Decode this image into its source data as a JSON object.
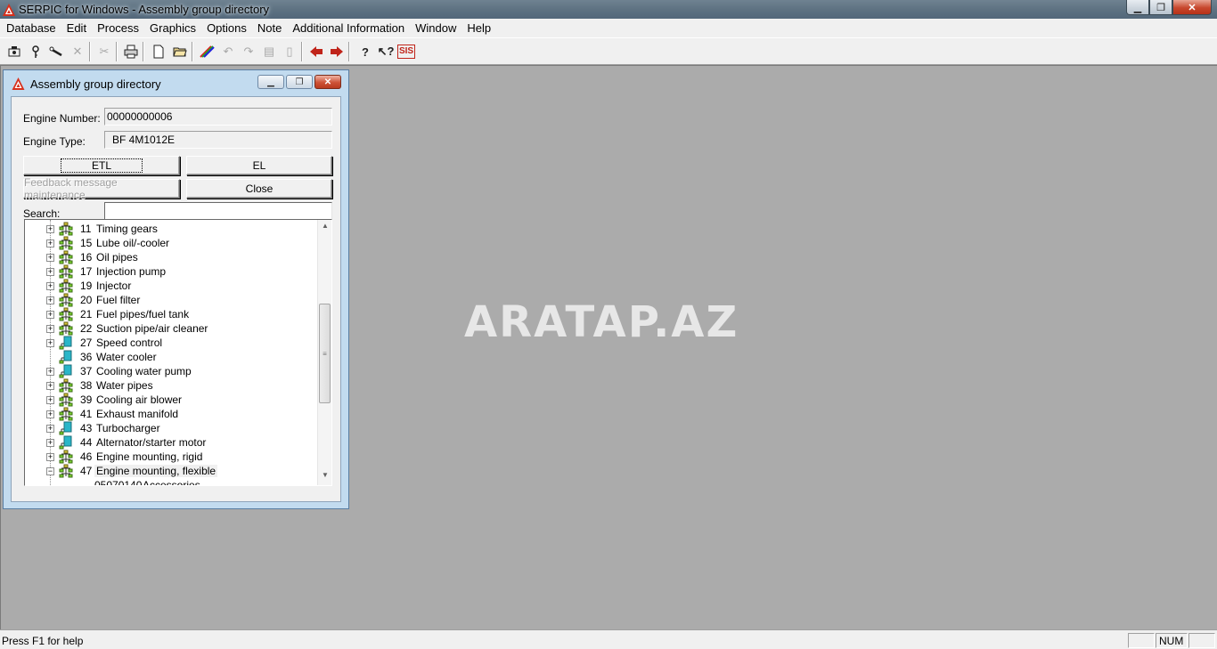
{
  "app": {
    "title": "SERPIC for Windows - Assembly group directory"
  },
  "menu": [
    "Database",
    "Edit",
    "Process",
    "Graphics",
    "Options",
    "Note",
    "Additional Information",
    "Window",
    "Help"
  ],
  "toolbar": {
    "icons": [
      "motor-icon",
      "key-icon",
      "wrench-icon",
      "delete-icon",
      "cut-icon",
      "print-icon",
      "new-document-icon",
      "open-folder-icon",
      "color-pencil-icon",
      "undo-icon",
      "redo-icon",
      "frame-icon",
      "page-icon",
      "arrow-left-icon",
      "arrow-right-icon",
      "help-icon",
      "context-help-icon",
      "sis-icon"
    ],
    "sis_label": "SIS"
  },
  "watermark": "ARATAP.AZ",
  "child_window": {
    "title": "Assembly group directory",
    "engine_number_label": "Engine Number:",
    "engine_number_value": "00000000006",
    "engine_type_label": "Engine Type:",
    "engine_type_value": "BF 4M1012E",
    "etl_button": "ETL",
    "el_button": "EL",
    "feedback_button": "Feedback message maintenance",
    "close_button": "Close",
    "search_label": "Search:",
    "search_value": ""
  },
  "tree": [
    {
      "num": "11",
      "name": "Timing gears",
      "icon": "assembly"
    },
    {
      "num": "15",
      "name": "Lube oil/-cooler",
      "icon": "assembly"
    },
    {
      "num": "16",
      "name": "Oil pipes",
      "icon": "assembly"
    },
    {
      "num": "17",
      "name": "Injection pump",
      "icon": "assembly"
    },
    {
      "num": "19",
      "name": "Injector",
      "icon": "assembly"
    },
    {
      "num": "20",
      "name": "Fuel filter",
      "icon": "assembly"
    },
    {
      "num": "21",
      "name": "Fuel pipes/fuel tank",
      "icon": "assembly"
    },
    {
      "num": "22",
      "name": "Suction pipe/air cleaner",
      "icon": "assembly"
    },
    {
      "num": "27",
      "name": "Speed control",
      "icon": "part"
    },
    {
      "num": "36",
      "name": "Water cooler",
      "icon": "part"
    },
    {
      "num": "37",
      "name": "Cooling water pump",
      "icon": "part"
    },
    {
      "num": "38",
      "name": "Water pipes",
      "icon": "assembly"
    },
    {
      "num": "39",
      "name": "Cooling air blower",
      "icon": "assembly"
    },
    {
      "num": "41",
      "name": "Exhaust manifold",
      "icon": "assembly"
    },
    {
      "num": "43",
      "name": "Turbocharger",
      "icon": "part"
    },
    {
      "num": "44",
      "name": "Alternator/starter motor",
      "icon": "part"
    },
    {
      "num": "46",
      "name": "Engine mounting, rigid",
      "icon": "assembly"
    },
    {
      "num": "47",
      "name": "Engine mounting, flexible",
      "icon": "assembly"
    }
  ],
  "tree_child": {
    "num": "05070140",
    "name": "Accessories"
  },
  "status": {
    "message": "Press F1 for help",
    "num": "NUM"
  }
}
